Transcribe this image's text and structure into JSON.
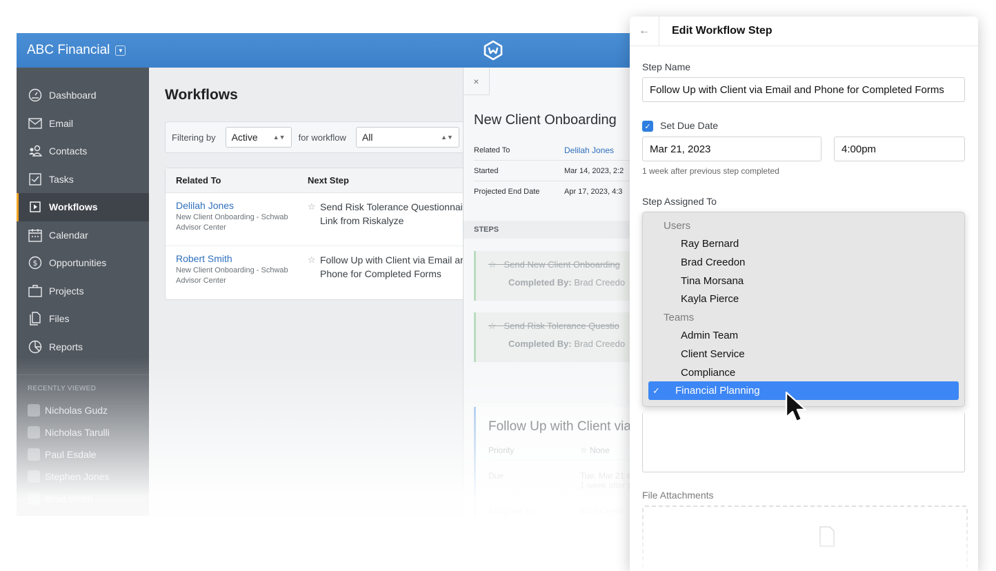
{
  "app": {
    "brand": "ABC Financial",
    "logo_icon": "wealthbox-logo-icon"
  },
  "sidebar": {
    "items": [
      {
        "label": "Dashboard",
        "icon": "dashboard-icon"
      },
      {
        "label": "Email",
        "icon": "envelope-icon"
      },
      {
        "label": "Contacts",
        "icon": "contacts-icon"
      },
      {
        "label": "Tasks",
        "icon": "checkbox-icon"
      },
      {
        "label": "Workflows",
        "icon": "play-icon",
        "active": true
      },
      {
        "label": "Calendar",
        "icon": "calendar-icon"
      },
      {
        "label": "Opportunities",
        "icon": "dollar-icon"
      },
      {
        "label": "Projects",
        "icon": "briefcase-icon"
      },
      {
        "label": "Files",
        "icon": "files-icon"
      },
      {
        "label": "Reports",
        "icon": "pie-chart-icon"
      }
    ],
    "recent_title": "RECENTLY VIEWED",
    "recent": [
      "Nicholas Gudz",
      "Nicholas Tarulli",
      "Paul Esdale",
      "Stephen Jones",
      "Brad Smith"
    ]
  },
  "main": {
    "title": "Workflows",
    "filter": {
      "label": "Filtering by",
      "status_value": "Active",
      "workflow_label": "for workflow",
      "workflow_value": "All"
    },
    "table": {
      "headers": [
        "Related To",
        "Next Step"
      ],
      "rows": [
        {
          "name": "Delilah Jones",
          "sub": "New Client Onboarding - Schwab Advisor Center",
          "next_step": "Send Risk Tolerance Questionnaire Link from Riskalyze"
        },
        {
          "name": "Robert Smith",
          "sub": "New Client Onboarding - Schwab Advisor Center",
          "next_step": "Follow Up with Client via Email and Phone for Completed Forms"
        }
      ]
    }
  },
  "detail": {
    "close": "×",
    "title": "New Client Onboarding",
    "meta": [
      {
        "label": "Related To",
        "value": "Delilah Jones"
      },
      {
        "label": "Started",
        "value": "Mar 14, 2023, 2:2"
      },
      {
        "label": "Projected End Date",
        "value": "Apr 17, 2023, 4:3"
      }
    ],
    "steps_header": "STEPS",
    "completed_steps": [
      {
        "title": "Send New Client Onboarding",
        "completed_by_label": "Completed By:",
        "completed_by": "Brad Creedo"
      },
      {
        "title": "Send Risk Tolerance Questio",
        "completed_by_label": "Completed By:",
        "completed_by": "Brad Creedo"
      }
    ],
    "active_step": {
      "title": "Follow Up with Client via",
      "rows": [
        {
          "label": "Priority",
          "value": "☆ None"
        },
        {
          "label": "Due",
          "value": "Tue, Mar 21 a",
          "value2": "1 week after p"
        },
        {
          "label": "Assigned To",
          "value": "Brad Creedo"
        }
      ]
    }
  },
  "panel": {
    "back": "←",
    "title": "Edit Workflow Step",
    "step_name_label": "Step Name",
    "step_name_value": "Follow Up with Client via Email and Phone for Completed Forms",
    "due_date_label": "Set Due Date",
    "due_date_value": "Mar 21, 2023",
    "due_time_value": "4:00pm",
    "due_hint": "1 week after previous step completed",
    "assigned_label": "Step Assigned To",
    "dropdown": {
      "groups": [
        {
          "label": "Users",
          "items": [
            "Ray Bernard",
            "Brad Creedon",
            "Tina Morsana",
            "Kayla Pierce"
          ]
        },
        {
          "label": "Teams",
          "items": [
            "Admin Team",
            "Client Service",
            "Compliance",
            "Financial Planning"
          ]
        }
      ],
      "selected": "Financial Planning"
    },
    "attachments_label": "File Attachments"
  }
}
